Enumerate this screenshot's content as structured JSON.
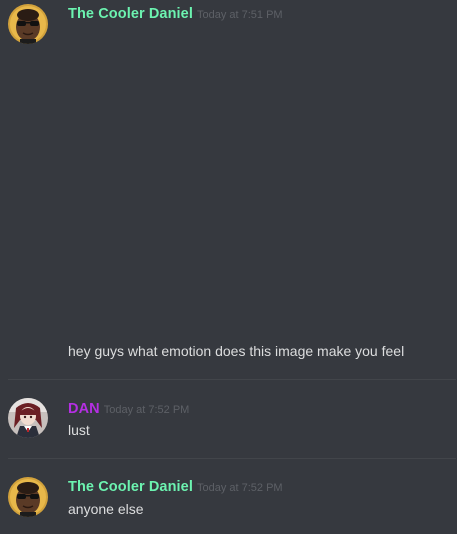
{
  "messages": [
    {
      "username": "The Cooler Daniel",
      "username_color": "#6cf3b0",
      "timestamp": "Today at 7:51 PM",
      "text": "hey guys what emotion does this image make you feel",
      "avatar_icon": "sunglasses-avatar-icon"
    },
    {
      "username": "DAN",
      "username_color": "#b52fe3",
      "timestamp": "Today at 7:52 PM",
      "text": "lust",
      "avatar_icon": "anime-avatar-icon"
    },
    {
      "username": "The Cooler Daniel",
      "username_color": "#6cf3b0",
      "timestamp": "Today at 7:52 PM",
      "text": "anyone else",
      "avatar_icon": "sunglasses-avatar-icon"
    }
  ],
  "colors": {
    "background": "#36393f",
    "message_text": "#dcddde",
    "timestamp": "#5d6066",
    "divider": "#42454a"
  }
}
